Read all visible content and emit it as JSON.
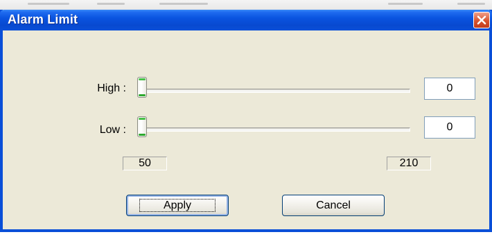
{
  "window": {
    "title": "Alarm Limit",
    "accent": "#0a4fd8"
  },
  "high": {
    "label": "High :",
    "value": "0"
  },
  "low": {
    "label": "Low :",
    "value": "0"
  },
  "range": {
    "min": "50",
    "max": "210"
  },
  "buttons": {
    "apply": "Apply",
    "cancel": "Cancel"
  },
  "icons": {
    "close": "close-icon"
  }
}
